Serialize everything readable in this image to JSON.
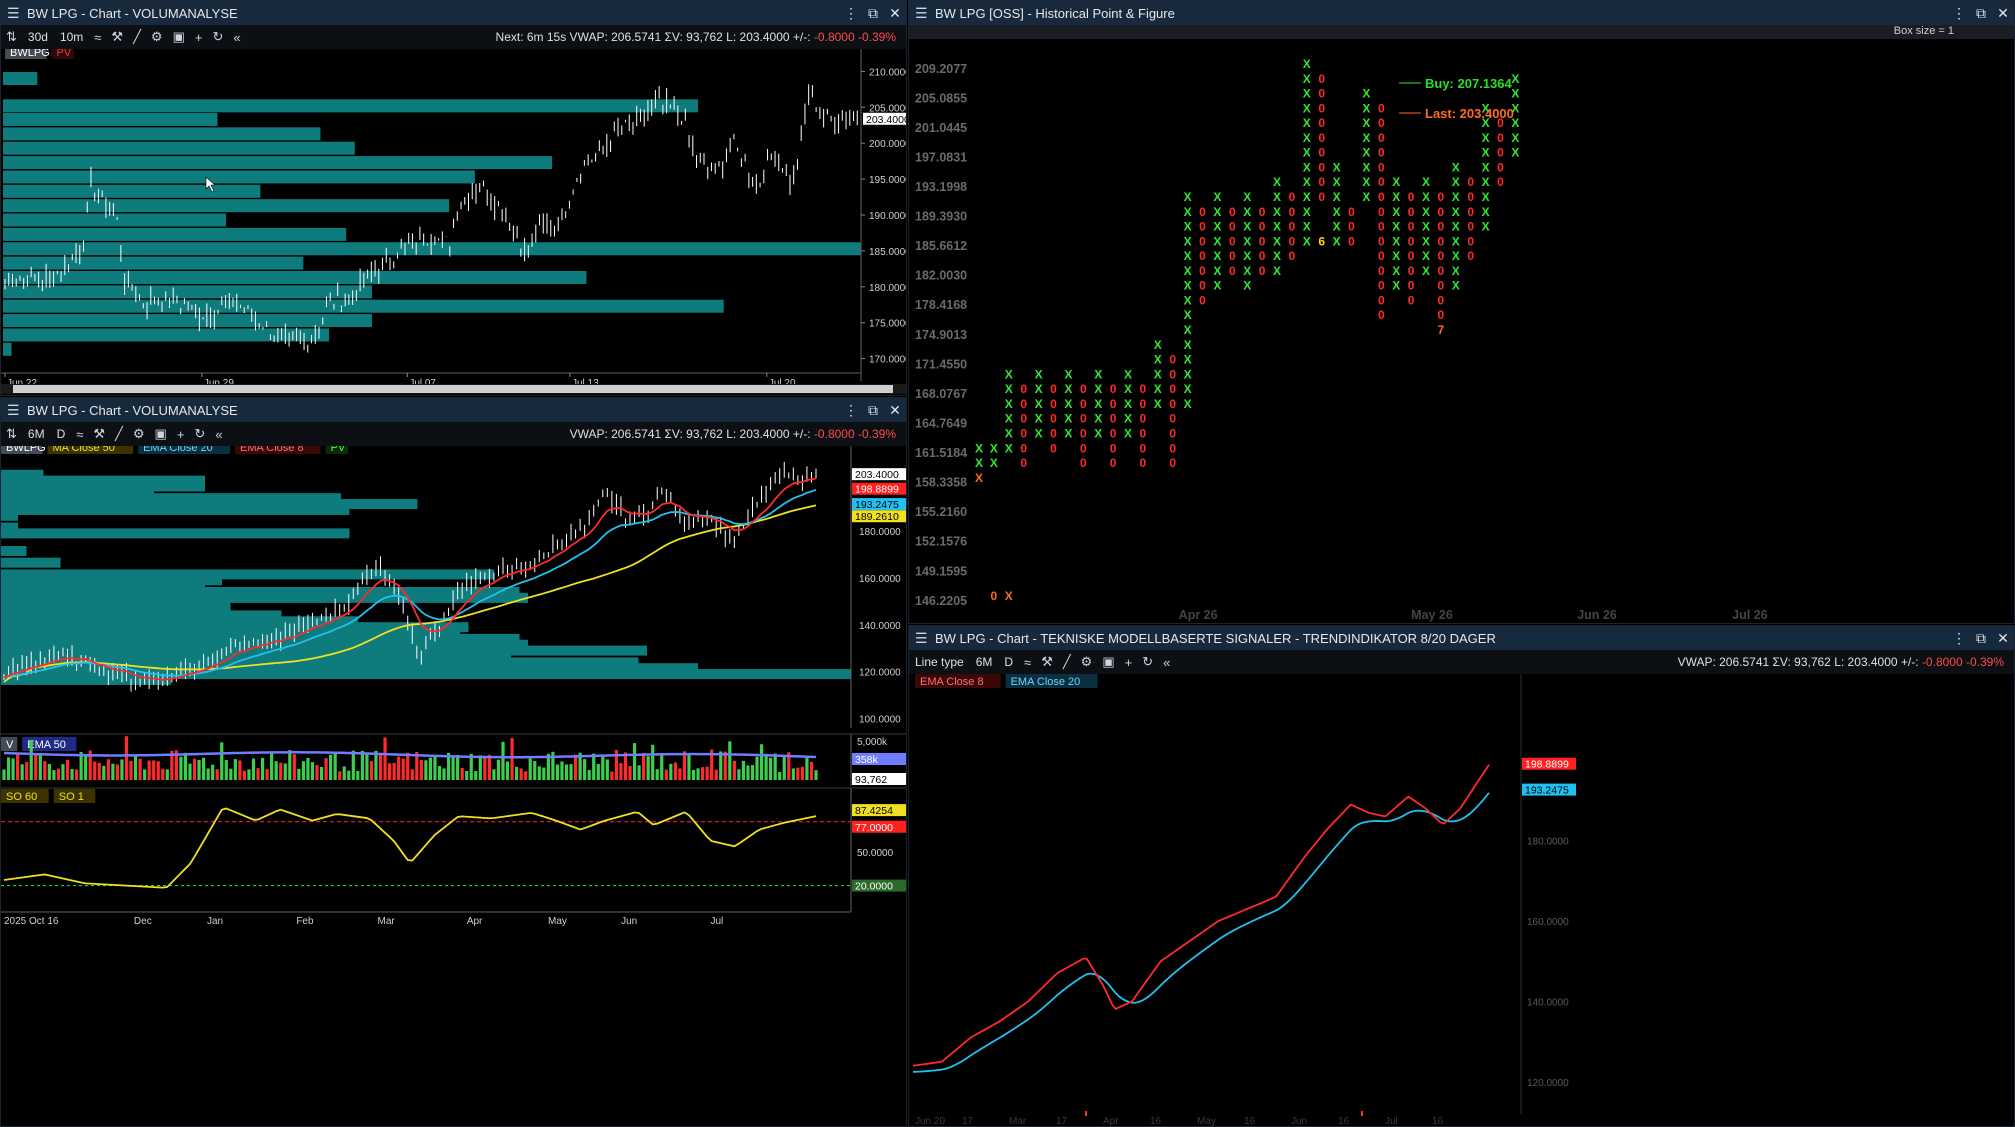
{
  "colors": {
    "teal": "#0e7b7d",
    "green": "#2fe82f",
    "red": "#ff2a2a",
    "yellow": "#f0e020",
    "cyan": "#22c0f0",
    "white": "#ffffff",
    "pnfOrange": "#ff6a20"
  },
  "p1": {
    "title": "BW LPG - Chart - VOLUMANALYSE",
    "toolbar": {
      "periods": [
        "30d",
        "10m"
      ],
      "info_pre": "Next: 6m 15s  VWAP: 206.5741  ΣV: 93,762  L: 203.4000  +/-:",
      "info_neg": "-0.8000  -0.39%"
    },
    "chips": [
      {
        "label": "BWLPG",
        "bg": "#444b55",
        "fg": "#ffffff"
      },
      {
        "label": "PV",
        "bg": "#2a0a0a",
        "fg": "#ff3030"
      }
    ],
    "yticks": [
      "210.0000",
      "205.0000",
      "200.0000",
      "195.0000",
      "190.0000",
      "185.0000",
      "180.0000",
      "175.0000",
      "170.0000"
    ],
    "ymin": 168.0,
    "ymax": 212.0,
    "last_label": "203.4000",
    "last": 203.4,
    "xlabels": [
      {
        "t": "Jun 22",
        "f": 0.0
      },
      {
        "t": "Jun 29",
        "f": 0.23
      },
      {
        "t": "Jul 07",
        "f": 0.47
      },
      {
        "t": "Jul 13",
        "f": 0.66
      },
      {
        "t": "Jul 20",
        "f": 0.89
      }
    ],
    "profile": [
      {
        "p": 209.0,
        "v": 0.04
      },
      {
        "p": 207.0,
        "v": 0.0
      },
      {
        "p": 205.2,
        "v": 0.81
      },
      {
        "p": 203.3,
        "v": 0.25
      },
      {
        "p": 201.3,
        "v": 0.37
      },
      {
        "p": 199.3,
        "v": 0.41
      },
      {
        "p": 197.3,
        "v": 0.64
      },
      {
        "p": 195.3,
        "v": 0.55
      },
      {
        "p": 193.3,
        "v": 0.3
      },
      {
        "p": 191.3,
        "v": 0.52
      },
      {
        "p": 189.3,
        "v": 0.26
      },
      {
        "p": 187.3,
        "v": 0.4
      },
      {
        "p": 185.3,
        "v": 1.0
      },
      {
        "p": 183.3,
        "v": 0.35
      },
      {
        "p": 181.3,
        "v": 0.68
      },
      {
        "p": 179.3,
        "v": 0.43
      },
      {
        "p": 177.3,
        "v": 0.84
      },
      {
        "p": 175.3,
        "v": 0.43
      },
      {
        "p": 173.3,
        "v": 0.38
      },
      {
        "p": 171.3,
        "v": 0.01
      }
    ],
    "anchors": [
      [
        0,
        181
      ],
      [
        0.05,
        181
      ],
      [
        0.08,
        184
      ],
      [
        0.09,
        185.5
      ],
      [
        0.1,
        194
      ],
      [
        0.13,
        190
      ],
      [
        0.135,
        186
      ],
      [
        0.14,
        181
      ],
      [
        0.16,
        178
      ],
      [
        0.2,
        178
      ],
      [
        0.23,
        176
      ],
      [
        0.27,
        178
      ],
      [
        0.3,
        175
      ],
      [
        0.33,
        172
      ],
      [
        0.36,
        173
      ],
      [
        0.38,
        178
      ],
      [
        0.41,
        179
      ],
      [
        0.43,
        182
      ],
      [
        0.47,
        186
      ],
      [
        0.5,
        187
      ],
      [
        0.52,
        186
      ],
      [
        0.53,
        192
      ],
      [
        0.56,
        194
      ],
      [
        0.59,
        189
      ],
      [
        0.61,
        184
      ],
      [
        0.62,
        188
      ],
      [
        0.65,
        189
      ],
      [
        0.67,
        196
      ],
      [
        0.72,
        202
      ],
      [
        0.74,
        203
      ],
      [
        0.76,
        205.5
      ],
      [
        0.79,
        204
      ],
      [
        0.81,
        197
      ],
      [
        0.83,
        196
      ],
      [
        0.85,
        200
      ],
      [
        0.88,
        194
      ],
      [
        0.9,
        199
      ],
      [
        0.92,
        194
      ],
      [
        0.94,
        208
      ],
      [
        0.955,
        203.4
      ]
    ]
  },
  "p2": {
    "title": "BW LPG - Chart - VOLUMANALYSE",
    "toolbar": {
      "periods": [
        "6M",
        "D"
      ],
      "info_pre": "VWAP: 206.5741  ΣV: 93,762  L: 203.4000  +/-:",
      "info_neg": "-0.8000  -0.39%"
    },
    "chips": [
      {
        "label": "BWLPG",
        "bg": "#444b55",
        "fg": "#ffffff"
      },
      {
        "label": "MA  Close 50",
        "bg": "#3b3400",
        "fg": "#f0e020"
      },
      {
        "label": "EMA  Close 20",
        "bg": "#0b2f3e",
        "fg": "#6ad6ff"
      },
      {
        "label": "EMA  Close 8",
        "bg": "#3b0808",
        "fg": "#ff7070"
      },
      {
        "label": "PV",
        "bg": "#0b2a0b",
        "fg": "#40ff40"
      }
    ],
    "yticks": [
      "180.0000",
      "160.0000",
      "140.0000",
      "120.0000",
      "100.0000"
    ],
    "ymin": 96,
    "ymax": 212,
    "price_labels": [
      {
        "v": "203.4000",
        "bg": "#ffffff",
        "fg": "#000000",
        "p": 203.4
      },
      {
        "v": "198.8899",
        "bg": "#ff2020",
        "fg": "#ffffff",
        "p": 198.9
      },
      {
        "v": "193.2475",
        "bg": "#22c0f0",
        "fg": "#000000",
        "p": 193.2
      },
      {
        "v": "189.2610",
        "bg": "#f0e020",
        "fg": "#000000",
        "p": 189.3
      }
    ],
    "xlabels": [
      {
        "t": "2025 Oct 16",
        "f": 0.0
      },
      {
        "t": "Dec",
        "f": 0.16
      },
      {
        "t": "Jan",
        "f": 0.25
      },
      {
        "t": "Feb",
        "f": 0.36
      },
      {
        "t": "Mar",
        "f": 0.46
      },
      {
        "t": "Apr",
        "f": 0.57
      },
      {
        "t": "May",
        "f": 0.67
      },
      {
        "t": "Jun",
        "f": 0.76
      },
      {
        "t": "Jul",
        "f": 0.87
      }
    ],
    "profile": [
      {
        "p": 204.0,
        "v": 0.05
      },
      {
        "p": 201.5,
        "v": 0.24
      },
      {
        "p": 199.0,
        "v": 0.24
      },
      {
        "p": 196.5,
        "v": 0.18
      },
      {
        "p": 194.0,
        "v": 0.4
      },
      {
        "p": 191.5,
        "v": 0.49
      },
      {
        "p": 189.0,
        "v": 0.41
      },
      {
        "p": 186.5,
        "v": 0.02
      },
      {
        "p": 184.0,
        "v": 0.0
      },
      {
        "p": 181.5,
        "v": 0.02
      },
      {
        "p": 179.0,
        "v": 0.41
      },
      {
        "p": 176.5,
        "v": 0.0
      },
      {
        "p": 171.5,
        "v": 0.03
      },
      {
        "p": 166.5,
        "v": 0.07
      },
      {
        "p": 161.5,
        "v": 0.58
      },
      {
        "p": 159.0,
        "v": 0.26
      },
      {
        "p": 156.5,
        "v": 0.24
      },
      {
        "p": 154.0,
        "v": 0.61
      },
      {
        "p": 151.5,
        "v": 0.62
      },
      {
        "p": 149.0,
        "v": 0.27
      },
      {
        "p": 146.5,
        "v": 0.27
      },
      {
        "p": 144.0,
        "v": 0.33
      },
      {
        "p": 141.5,
        "v": 0.42
      },
      {
        "p": 139.0,
        "v": 0.55
      },
      {
        "p": 136.5,
        "v": 0.54
      },
      {
        "p": 134.0,
        "v": 0.61
      },
      {
        "p": 131.5,
        "v": 0.62
      },
      {
        "p": 129.0,
        "v": 0.76
      },
      {
        "p": 126.5,
        "v": 0.6
      },
      {
        "p": 124.0,
        "v": 0.75
      },
      {
        "p": 121.5,
        "v": 0.82
      },
      {
        "p": 119.0,
        "v": 1.0
      },
      {
        "p": 116.5,
        "v": 0.2
      }
    ],
    "anchors": [
      [
        0,
        119
      ],
      [
        0.06,
        127
      ],
      [
        0.1,
        124
      ],
      [
        0.13,
        120
      ],
      [
        0.17,
        116
      ],
      [
        0.2,
        117
      ],
      [
        0.25,
        124
      ],
      [
        0.28,
        131
      ],
      [
        0.33,
        133
      ],
      [
        0.37,
        139
      ],
      [
        0.42,
        148
      ],
      [
        0.46,
        166
      ],
      [
        0.48,
        156
      ],
      [
        0.5,
        140
      ],
      [
        0.51,
        126
      ],
      [
        0.53,
        136
      ],
      [
        0.56,
        155
      ],
      [
        0.6,
        162
      ],
      [
        0.63,
        164
      ],
      [
        0.66,
        168
      ],
      [
        0.69,
        177
      ],
      [
        0.72,
        182
      ],
      [
        0.74,
        197
      ],
      [
        0.77,
        184
      ],
      [
        0.8,
        191
      ],
      [
        0.81,
        197
      ],
      [
        0.84,
        183
      ],
      [
        0.86,
        187
      ],
      [
        0.88,
        182
      ],
      [
        0.9,
        176
      ],
      [
        0.92,
        188
      ],
      [
        0.94,
        196
      ],
      [
        0.955,
        203.4
      ]
    ],
    "vol_chips": [
      {
        "label": "V",
        "bg": "#444b55",
        "fg": "#ffffff"
      },
      {
        "label": "EMA  50",
        "bg": "#1f2a8a",
        "fg": "#ffffff"
      }
    ],
    "vol_labels": [
      "5,000k",
      "358k",
      "93,762"
    ],
    "so_chips": [
      {
        "label": "SO  60",
        "bg": "#3b3400",
        "fg": "#f0e020"
      },
      {
        "label": "SO  1",
        "bg": "#3b3400",
        "fg": "#f0e020"
      }
    ],
    "so_labels": [
      "87.4254",
      "77.0000",
      "50.0000",
      "20.0000"
    ]
  },
  "p3": {
    "title": "BW LPG [OSS] - Historical Point & Figure",
    "boxsize_label": "Box size = 1",
    "yticks": [
      "209.2077",
      "205.0855",
      "201.0445",
      "197.0831",
      "193.1998",
      "189.3930",
      "185.6612",
      "182.0030",
      "178.4168",
      "174.9013",
      "171.4550",
      "168.0767",
      "164.7649",
      "161.5184",
      "158.3358",
      "155.2160",
      "152.1576",
      "149.1595",
      "146.2205"
    ],
    "xlabels": [
      {
        "t": "Apr 26",
        "f": 0.24
      },
      {
        "t": "May 26",
        "f": 0.45
      },
      {
        "t": "Jun 26",
        "f": 0.6
      },
      {
        "t": "Jul 26",
        "f": 0.74
      }
    ],
    "buy_label": "Buy: 207.1364",
    "last_label": "Last: 203.4000",
    "columns": [
      [
        [
          "X",
          0
        ],
        [
          "X",
          1
        ],
        [
          "X",
          2
        ]
      ],
      [
        [
          "X",
          0
        ],
        [
          "0",
          1
        ],
        [
          "0",
          10
        ]
      ],
      [
        [
          "X",
          0
        ],
        [
          "X",
          -5
        ],
        [
          "X",
          10
        ]
      ],
      [
        [
          "0",
          -4
        ],
        [
          "0",
          1
        ]
      ],
      [
        [
          "X",
          -5
        ],
        [
          "X",
          -1
        ]
      ],
      [
        [
          "0",
          -4
        ],
        [
          "0",
          0
        ]
      ],
      [
        [
          "X",
          -5
        ],
        [
          "X",
          -1
        ]
      ],
      [
        [
          "0",
          -4
        ],
        [
          "0",
          1
        ]
      ],
      [
        [
          "X",
          -5
        ],
        [
          "X",
          -1
        ]
      ],
      [
        [
          "0",
          -4
        ],
        [
          "0",
          1
        ]
      ],
      [
        [
          "X",
          -5
        ],
        [
          "X",
          -1
        ]
      ],
      [
        [
          "0",
          -4
        ],
        [
          "0",
          1
        ]
      ],
      [
        [
          "X",
          -7
        ],
        [
          "X",
          -3
        ]
      ],
      [
        [
          "0",
          -6
        ],
        [
          "0",
          1
        ]
      ],
      [
        [
          "X",
          -17
        ],
        [
          "X",
          -3
        ]
      ],
      [
        [
          "0",
          -16
        ],
        [
          "0",
          -10
        ]
      ],
      [
        [
          "X",
          -17
        ],
        [
          "X",
          -11
        ]
      ],
      [
        [
          "0",
          -16
        ],
        [
          "0",
          -12
        ]
      ],
      [
        [
          "X",
          -17
        ],
        [
          "X",
          -11
        ]
      ],
      [
        [
          "0",
          -16
        ],
        [
          "0",
          -12
        ]
      ],
      [
        [
          "X",
          -18
        ],
        [
          "X",
          -12
        ]
      ],
      [
        [
          "0",
          -17
        ],
        [
          "0",
          -13
        ]
      ],
      [
        [
          "X",
          -26
        ],
        [
          "X",
          -14
        ]
      ],
      [
        [
          "0",
          -25
        ],
        [
          "0",
          -17
        ],
        [
          "6",
          -14
        ]
      ],
      [
        [
          "X",
          -19
        ],
        [
          "X",
          -14
        ]
      ],
      [
        [
          "0",
          -16
        ],
        [
          "0",
          -14
        ]
      ],
      [
        [
          "X",
          -24
        ],
        [
          "X",
          -17
        ]
      ],
      [
        [
          "0",
          -23
        ],
        [
          "0",
          -9
        ]
      ],
      [
        [
          "X",
          -18
        ],
        [
          "X",
          -11
        ]
      ],
      [
        [
          "0",
          -17
        ],
        [
          "0",
          -10
        ]
      ],
      [
        [
          "X",
          -18
        ],
        [
          "X",
          -12
        ]
      ],
      [
        [
          "0",
          -17
        ],
        [
          "0",
          -9
        ],
        [
          "7",
          -8
        ]
      ],
      [
        [
          "X",
          -19
        ],
        [
          "X",
          -11
        ]
      ],
      [
        [
          "0",
          -18
        ],
        [
          "0",
          -13
        ]
      ],
      [
        [
          "X",
          -23
        ],
        [
          "X",
          -15
        ]
      ],
      [
        [
          "0",
          -22
        ],
        [
          "0",
          -18
        ]
      ],
      [
        [
          "X",
          -25
        ],
        [
          "X",
          -20
        ]
      ]
    ]
  },
  "p4": {
    "title": "BW LPG - Chart - TEKNISKE MODELLBASERTE SIGNALER - TRENDINDIKATOR 8/20 DAGER",
    "toolbar": {
      "line_type": "Line type",
      "periods": [
        "6M",
        "D"
      ],
      "info_pre": "VWAP: 206.5741  ΣV: 93,762  L: 203.4000  +/-:",
      "info_neg": "-0.8000  -0.39%"
    },
    "chips": [
      {
        "label": "EMA  Close 8",
        "bg": "#3b0808",
        "fg": "#ff7070"
      },
      {
        "label": "EMA  Close 20",
        "bg": "#0b2f3e",
        "fg": "#6ad6ff"
      }
    ],
    "yticks": [
      "180.0000",
      "160.0000",
      "140.0000",
      "120.0000"
    ],
    "ymin": 112,
    "ymax": 214,
    "price_labels": [
      {
        "v": "198.8899",
        "bg": "#ff2020",
        "fg": "#ffffff",
        "p": 198.9
      },
      {
        "v": "193.2475",
        "bg": "#22c0f0",
        "fg": "#000000",
        "p": 193.2
      }
    ],
    "xlabels": [
      "Jun 20",
      "17",
      "Mar",
      "17",
      "Apr",
      "16",
      "May",
      "16",
      "Jun",
      "16",
      "Jul",
      "16"
    ]
  }
}
